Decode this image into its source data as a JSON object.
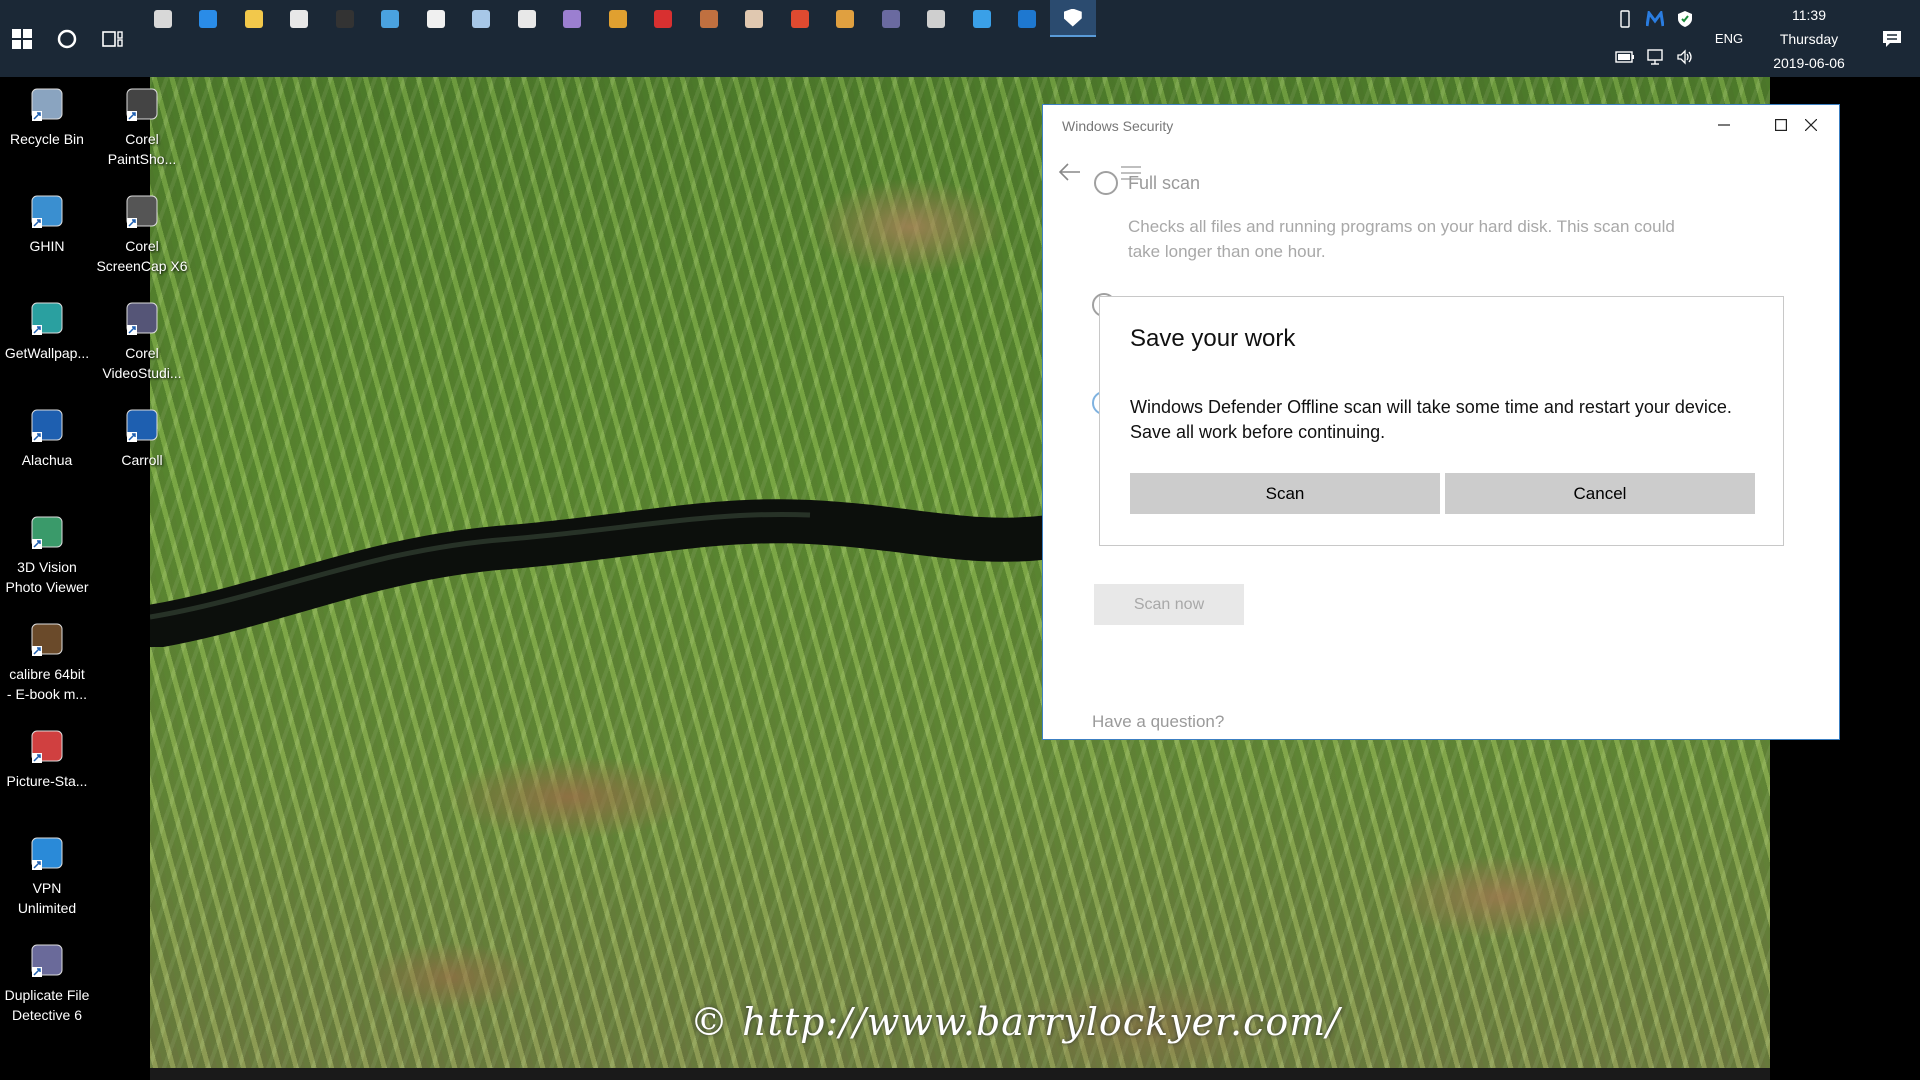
{
  "taskbar": {
    "apps": [
      {
        "name": "settings-icon",
        "color": "#d8d8d8"
      },
      {
        "name": "edge-icon",
        "color": "#2a8ce8"
      },
      {
        "name": "file-explorer-icon",
        "color": "#f2c84b"
      },
      {
        "name": "store-icon",
        "color": "#e8e8e8"
      },
      {
        "name": "terminal-icon",
        "color": "#333333"
      },
      {
        "name": "remote-desktop-icon",
        "color": "#4aa2e0"
      },
      {
        "name": "mail-icon",
        "color": "#f0f0f0"
      },
      {
        "name": "notes-icon",
        "color": "#a7c7e7"
      },
      {
        "name": "window-app-icon",
        "color": "#e8e8e8"
      },
      {
        "name": "pen-app-icon",
        "color": "#9b7fd0"
      },
      {
        "name": "paint-app-icon",
        "color": "#e0a030"
      },
      {
        "name": "red-app-icon",
        "color": "#d83030"
      },
      {
        "name": "media-app-icon",
        "color": "#c07040"
      },
      {
        "name": "document-app-icon",
        "color": "#e0c8b0"
      },
      {
        "name": "corel-app-icon",
        "color": "#e04a30"
      },
      {
        "name": "books-app-icon",
        "color": "#e0a040"
      },
      {
        "name": "video-app-icon",
        "color": "#6a6aa0"
      },
      {
        "name": "camera-app-icon",
        "color": "#cfcfcf"
      },
      {
        "name": "ie-icon",
        "color": "#3aa0e8"
      },
      {
        "name": "outlook-icon",
        "color": "#1e78d0"
      },
      {
        "name": "windows-security-icon",
        "color": "#ffffff",
        "active": true
      }
    ],
    "tray": {
      "language": "ENG",
      "time": "11:39",
      "day": "Thursday",
      "date": "2019-06-06"
    }
  },
  "desktop": {
    "icons": [
      {
        "label": "Recycle Bin",
        "name": "recycle-bin-icon",
        "color": "#8aa4c0"
      },
      {
        "label": "Corel\nPaintSho...",
        "name": "corel-paintshop-icon",
        "color": "#444444"
      },
      {
        "label": "GHIN",
        "name": "ghin-icon",
        "color": "#3a8fd0"
      },
      {
        "label": "Corel\nScreenCap X6",
        "name": "corel-screencap-icon",
        "color": "#555555"
      },
      {
        "label": "GetWallpap...",
        "name": "getwallpaper-icon",
        "color": "#2aa0a0"
      },
      {
        "label": "Corel\nVideoStudi...",
        "name": "corel-videostudio-icon",
        "color": "#555577"
      },
      {
        "label": "Alachua",
        "name": "alachua-shortcut-icon",
        "color": "#1e5fb0"
      },
      {
        "label": "Carroll",
        "name": "carroll-shortcut-icon",
        "color": "#1e5fb0"
      },
      {
        "label": "3D Vision\nPhoto Viewer",
        "name": "3d-vision-photo-viewer-icon",
        "color": "#3a9a6a"
      },
      {
        "label": "calibre 64bit\n- E-book m...",
        "name": "calibre-icon",
        "color": "#6a4a2a"
      },
      {
        "label": "Picture-Sta...",
        "name": "picture-station-icon",
        "color": "#d04040"
      },
      {
        "label": "VPN\nUnlimited",
        "name": "vpn-unlimited-icon",
        "color": "#2a8ad8"
      },
      {
        "label": "Duplicate File\nDetective 6",
        "name": "duplicate-file-detective-icon",
        "color": "#6a6a9a"
      }
    ],
    "watermark": "© http://www.barrylockyer.com/"
  },
  "window": {
    "title": "Windows Security",
    "option_title": "Full scan",
    "option_desc": "Checks all files and running programs on your hard disk. This scan could take longer than one hour.",
    "scan_now": "Scan now",
    "have_question": "Have a question?"
  },
  "dialog": {
    "title": "Save your work",
    "body": "Windows Defender Offline scan will take some time and restart your device. Save all work before continuing.",
    "scan_label": "Scan",
    "cancel_label": "Cancel"
  }
}
